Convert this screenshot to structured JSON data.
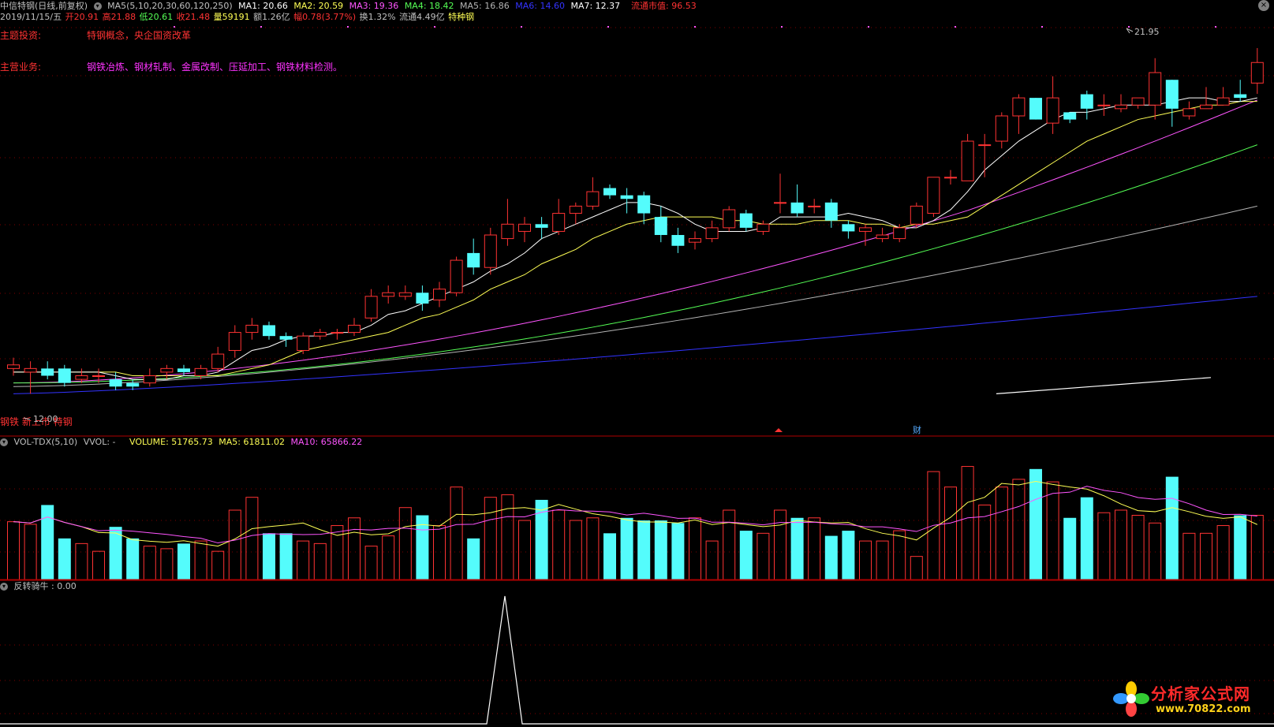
{
  "colors": {
    "up": "#ff3333",
    "down": "#54fcfc",
    "ma1": "#ffffff",
    "ma2": "#ffff55",
    "ma3": "#ff55ff",
    "ma4": "#55ff55",
    "ma5": "#b4b4b4",
    "ma6": "#3333ff",
    "ma7": "#ffffff",
    "vma5": "#ffff55",
    "vma10": "#ff55ff",
    "grid": "#800000"
  },
  "header": {
    "stock_name": "中信特钢(日线,前复权)",
    "ma_title": "MA5(5,10,20,30,60,120,250)",
    "ma1": "MA1: 20.66",
    "ma2": "MA2: 20.59",
    "ma3": "MA3: 19.36",
    "ma4": "MA4: 18.42",
    "ma5": "MA5: 16.86",
    "ma6": "MA6: 14.60",
    "ma7": "MA7: 12.37",
    "mcap_label": "流通市值: 96.53"
  },
  "quote": {
    "date": "2019/11/15/五",
    "open": "开20.91",
    "high": "高21.88",
    "low": "低20.61",
    "close": "收21.48",
    "volume": "量59191",
    "amount": "额1.26亿",
    "change": "幅0.78(3.77%)",
    "turnover": "换1.32%",
    "float": "流通4.49亿",
    "sector": "特种钢"
  },
  "info": {
    "theme_label": "主题投资:",
    "theme_value": "特钢概念，央企国资改革",
    "business_label": "主营业务:",
    "business_value": "钢铁冶炼、钢材轧制、金属改制、压延加工、钢铁材料检测。"
  },
  "bottom_tags": "钢铁 新上市 特钢",
  "price_high_label": "21.95",
  "price_low_label": "12.00",
  "event_marker": "财",
  "vol_header": {
    "title": "VOL-TDX(5,10)",
    "vvol": "VVOL: -",
    "volume": "VOLUME: 51765.73",
    "ma5": "MA5: 61811.02",
    "ma10": "MA10: 65866.22"
  },
  "ind_header": {
    "title": "反转骑牛",
    "value": ": 0.00"
  },
  "logo": {
    "name": "分析家公式网",
    "url": "www.70822.com"
  },
  "chart_data": {
    "type": "candlestick",
    "ylim": [
      11.5,
      22.6
    ],
    "candles": [
      [
        13.0,
        13.1,
        13.3,
        12.8
      ],
      [
        12.9,
        13.0,
        13.2,
        12.3
      ],
      [
        13.0,
        12.8,
        13.2,
        12.7
      ],
      [
        13.0,
        12.6,
        13.1,
        12.5
      ],
      [
        12.7,
        12.8,
        13.0,
        12.6
      ],
      [
        12.8,
        12.8,
        13.0,
        12.6
      ],
      [
        12.7,
        12.5,
        12.9,
        12.4
      ],
      [
        12.6,
        12.5,
        12.7,
        12.4
      ],
      [
        12.6,
        12.8,
        13.0,
        12.5
      ],
      [
        12.9,
        13.0,
        13.1,
        12.7
      ],
      [
        13.0,
        12.9,
        13.1,
        12.8
      ],
      [
        12.8,
        13.0,
        13.1,
        12.7
      ],
      [
        13.0,
        13.4,
        13.6,
        12.9
      ],
      [
        13.5,
        14.0,
        14.2,
        13.3
      ],
      [
        14.0,
        14.2,
        14.4,
        13.8
      ],
      [
        14.2,
        13.9,
        14.3,
        13.8
      ],
      [
        13.9,
        13.8,
        14.0,
        13.6
      ],
      [
        13.5,
        13.9,
        14.0,
        13.4
      ],
      [
        13.9,
        14.0,
        14.1,
        13.8
      ],
      [
        14.0,
        14.0,
        14.1,
        13.8
      ],
      [
        14.0,
        14.2,
        14.4,
        13.9
      ],
      [
        14.4,
        15.0,
        15.2,
        14.3
      ],
      [
        15.0,
        15.1,
        15.3,
        14.8
      ],
      [
        15.0,
        15.1,
        15.3,
        14.9
      ],
      [
        15.1,
        14.8,
        15.3,
        14.6
      ],
      [
        14.9,
        15.2,
        15.4,
        14.7
      ],
      [
        15.1,
        16.0,
        16.1,
        15.0
      ],
      [
        16.2,
        15.8,
        16.6,
        15.6
      ],
      [
        15.8,
        16.7,
        16.9,
        15.6
      ],
      [
        16.6,
        17.0,
        17.7,
        16.4
      ],
      [
        16.8,
        17.0,
        17.2,
        16.5
      ],
      [
        17.0,
        16.9,
        17.2,
        16.6
      ],
      [
        16.8,
        17.3,
        17.7,
        16.7
      ],
      [
        17.3,
        17.5,
        17.6,
        17.0
      ],
      [
        17.5,
        17.9,
        18.3,
        17.4
      ],
      [
        18.0,
        17.8,
        18.1,
        17.7
      ],
      [
        17.8,
        17.7,
        18.0,
        17.3
      ],
      [
        17.8,
        17.3,
        17.9,
        17.0
      ],
      [
        17.2,
        16.7,
        17.5,
        16.5
      ],
      [
        16.7,
        16.4,
        16.9,
        16.2
      ],
      [
        16.5,
        16.6,
        16.8,
        16.3
      ],
      [
        16.6,
        16.9,
        17.1,
        16.5
      ],
      [
        16.9,
        17.4,
        17.5,
        16.8
      ],
      [
        17.3,
        16.9,
        17.4,
        16.8
      ],
      [
        16.8,
        17.0,
        17.1,
        16.7
      ],
      [
        17.6,
        17.6,
        18.4,
        17.3
      ],
      [
        17.6,
        17.3,
        18.1,
        17.2
      ],
      [
        17.5,
        17.5,
        17.7,
        17.3
      ],
      [
        17.6,
        17.1,
        17.7,
        16.9
      ],
      [
        17.0,
        16.8,
        17.1,
        16.6
      ],
      [
        16.8,
        16.9,
        17.0,
        16.4
      ],
      [
        16.6,
        16.7,
        16.9,
        16.5
      ],
      [
        16.6,
        16.9,
        17.0,
        16.5
      ],
      [
        17.0,
        17.5,
        17.6,
        16.9
      ],
      [
        17.3,
        18.3,
        18.3,
        17.2
      ],
      [
        18.3,
        18.3,
        18.5,
        18.1
      ],
      [
        18.2,
        19.3,
        19.5,
        18.2
      ],
      [
        19.2,
        19.2,
        19.5,
        18.3
      ],
      [
        19.3,
        20.0,
        20.1,
        19.1
      ],
      [
        20.0,
        20.5,
        20.6,
        19.5
      ],
      [
        20.5,
        19.9,
        20.5,
        19.9
      ],
      [
        19.8,
        20.5,
        21.1,
        19.5
      ],
      [
        20.1,
        19.9,
        20.1,
        19.8
      ],
      [
        20.6,
        20.2,
        20.7,
        19.9
      ],
      [
        20.3,
        20.3,
        20.6,
        20.0
      ],
      [
        20.2,
        20.3,
        20.6,
        20.1
      ],
      [
        20.3,
        20.5,
        20.5,
        20.2
      ],
      [
        20.3,
        21.2,
        21.6,
        19.9
      ],
      [
        21.0,
        20.2,
        21.0,
        19.7
      ],
      [
        20.0,
        20.2,
        20.4,
        19.9
      ],
      [
        20.2,
        20.3,
        20.8,
        20.2
      ],
      [
        20.3,
        20.5,
        20.8,
        20.3
      ],
      [
        20.6,
        20.5,
        21.0,
        20.4
      ],
      [
        20.91,
        21.48,
        21.88,
        20.61
      ]
    ],
    "ma_lines": {
      "ma1": [
        12.9,
        12.9,
        12.9,
        12.9,
        12.9,
        12.9,
        12.8,
        12.7,
        12.7,
        12.7,
        12.8,
        12.8,
        12.9,
        13.2,
        13.5,
        13.6,
        13.8,
        13.9,
        13.9,
        14.0,
        14.0,
        14.2,
        14.5,
        14.6,
        14.8,
        15.0,
        15.2,
        15.4,
        15.7,
        15.9,
        16.2,
        16.6,
        16.8,
        17.0,
        17.2,
        17.4,
        17.6,
        17.6,
        17.5,
        17.3,
        17.0,
        16.8,
        16.8,
        16.8,
        16.9,
        17.2,
        17.2,
        17.2,
        17.2,
        17.3,
        17.2,
        17.1,
        16.9,
        16.9,
        17.1,
        17.4,
        17.9,
        18.5,
        18.9,
        19.3,
        19.6,
        19.9,
        20.1,
        20.1,
        20.2,
        20.3,
        20.3,
        20.3,
        20.4,
        20.5,
        20.5,
        20.4,
        20.4,
        20.5
      ],
      "ma2": [
        12.9,
        12.9,
        12.9,
        12.9,
        12.9,
        12.9,
        12.9,
        12.8,
        12.8,
        12.8,
        12.8,
        12.8,
        12.8,
        12.9,
        13.0,
        13.1,
        13.3,
        13.5,
        13.6,
        13.7,
        13.8,
        13.9,
        14.0,
        14.2,
        14.4,
        14.5,
        14.7,
        14.9,
        15.2,
        15.4,
        15.6,
        15.9,
        16.1,
        16.3,
        16.6,
        16.8,
        17.0,
        17.1,
        17.2,
        17.2,
        17.2,
        17.2,
        17.1,
        17.1,
        17.0,
        17.0,
        17.0,
        17.1,
        17.1,
        17.1,
        17.0,
        17.0,
        16.9,
        17.0,
        17.0,
        17.1,
        17.2,
        17.5,
        17.8,
        18.1,
        18.4,
        18.7,
        19.0,
        19.3,
        19.5,
        19.7,
        19.9,
        20.0,
        20.1,
        20.2,
        20.3,
        20.3,
        20.4,
        20.4
      ]
    }
  }
}
